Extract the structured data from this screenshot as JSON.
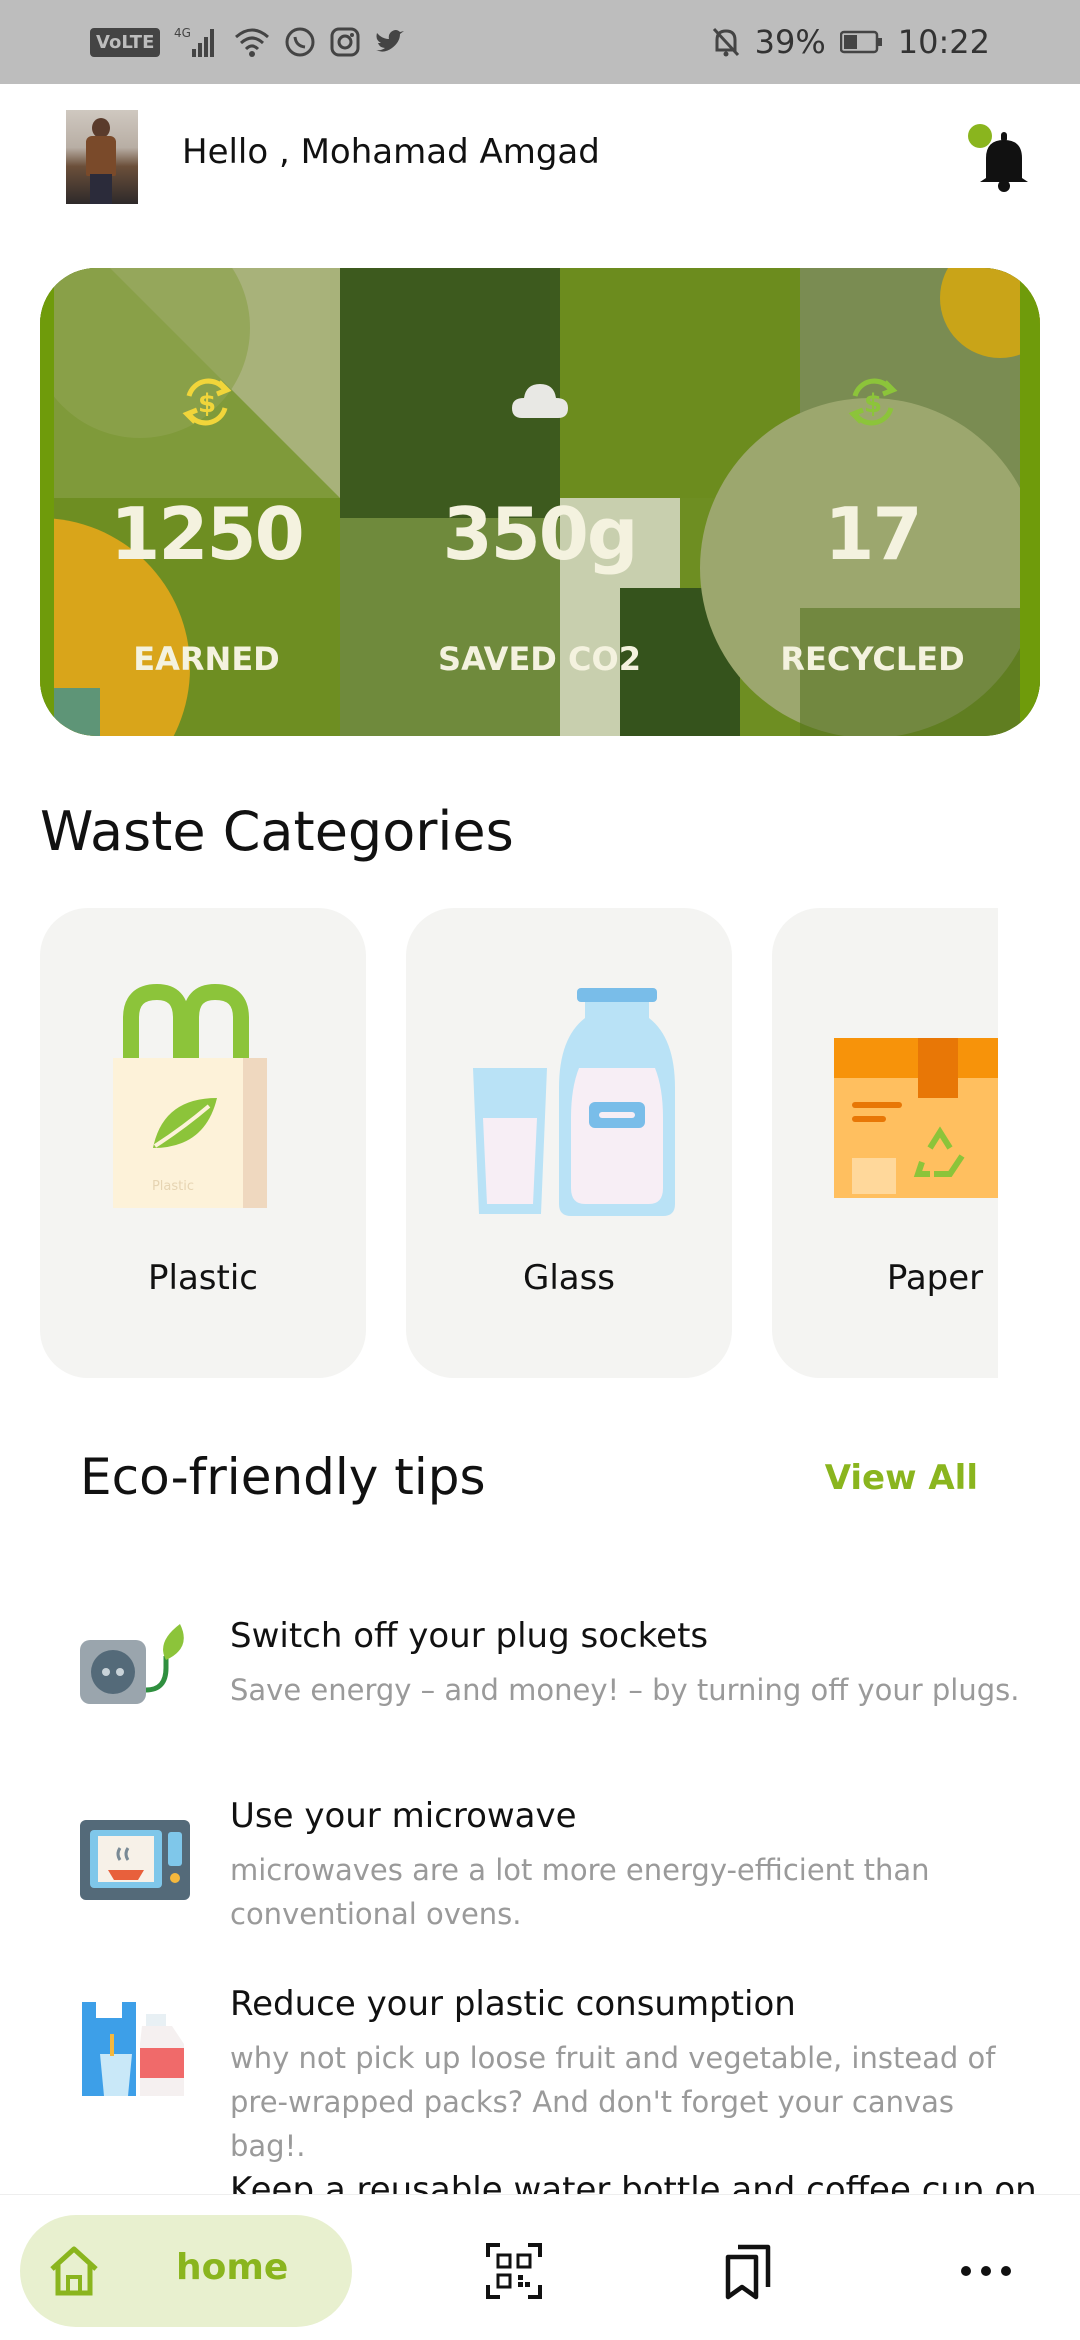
{
  "status_bar": {
    "network": "VoLTE",
    "network_type": "4G",
    "battery": "39%",
    "time": "10:22",
    "icons": [
      "signal-icon",
      "wifi-icon",
      "whatsapp-icon",
      "instagram-icon",
      "twitter-icon",
      "bell-off-icon",
      "battery-icon"
    ]
  },
  "header": {
    "greeting": "Hello , Mohamad Amgad",
    "notification_dot_color": "#8ab51e"
  },
  "stats": [
    {
      "icon": "currency-exchange-icon",
      "value": "1250",
      "label": "EARNED"
    },
    {
      "icon": "cloud-icon",
      "value": "350g",
      "label": "SAVED CO2"
    },
    {
      "icon": "recycle-icon",
      "value": "17",
      "label": "RECYCLED"
    }
  ],
  "categories": {
    "title": "Waste Categories",
    "items": [
      {
        "label": "Plastic",
        "icon": "plastic-bag-icon",
        "bag_text": "Plastic"
      },
      {
        "label": "Glass",
        "icon": "glass-bottle-icon"
      },
      {
        "label": "Paper",
        "icon": "paper-box-icon"
      }
    ]
  },
  "tips": {
    "title": "Eco-friendly tips",
    "view_all": "View All",
    "items": [
      {
        "icon": "plug-socket-icon",
        "title": "Switch off your plug sockets",
        "desc": "Save energy – and money! – by turning off your plugs."
      },
      {
        "icon": "microwave-icon",
        "title": "Use your microwave",
        "desc": "microwaves are a lot more energy-efficient than conventional ovens."
      },
      {
        "icon": "plastic-consumption-icon",
        "title": "Reduce your plastic consumption",
        "desc": "why not pick up loose fruit and vegetable, instead of pre-wrapped packs? And don't forget your canvas bag!."
      },
      {
        "icon": "water-bottle-icon",
        "title": "Keep a reusable water bottle and coffee cup on",
        "desc": ""
      }
    ]
  },
  "nav": {
    "home": "home",
    "accent": "#8ab51e",
    "items": [
      "home-icon",
      "qr-code-icon",
      "bookmarks-icon",
      "more-icon"
    ]
  }
}
